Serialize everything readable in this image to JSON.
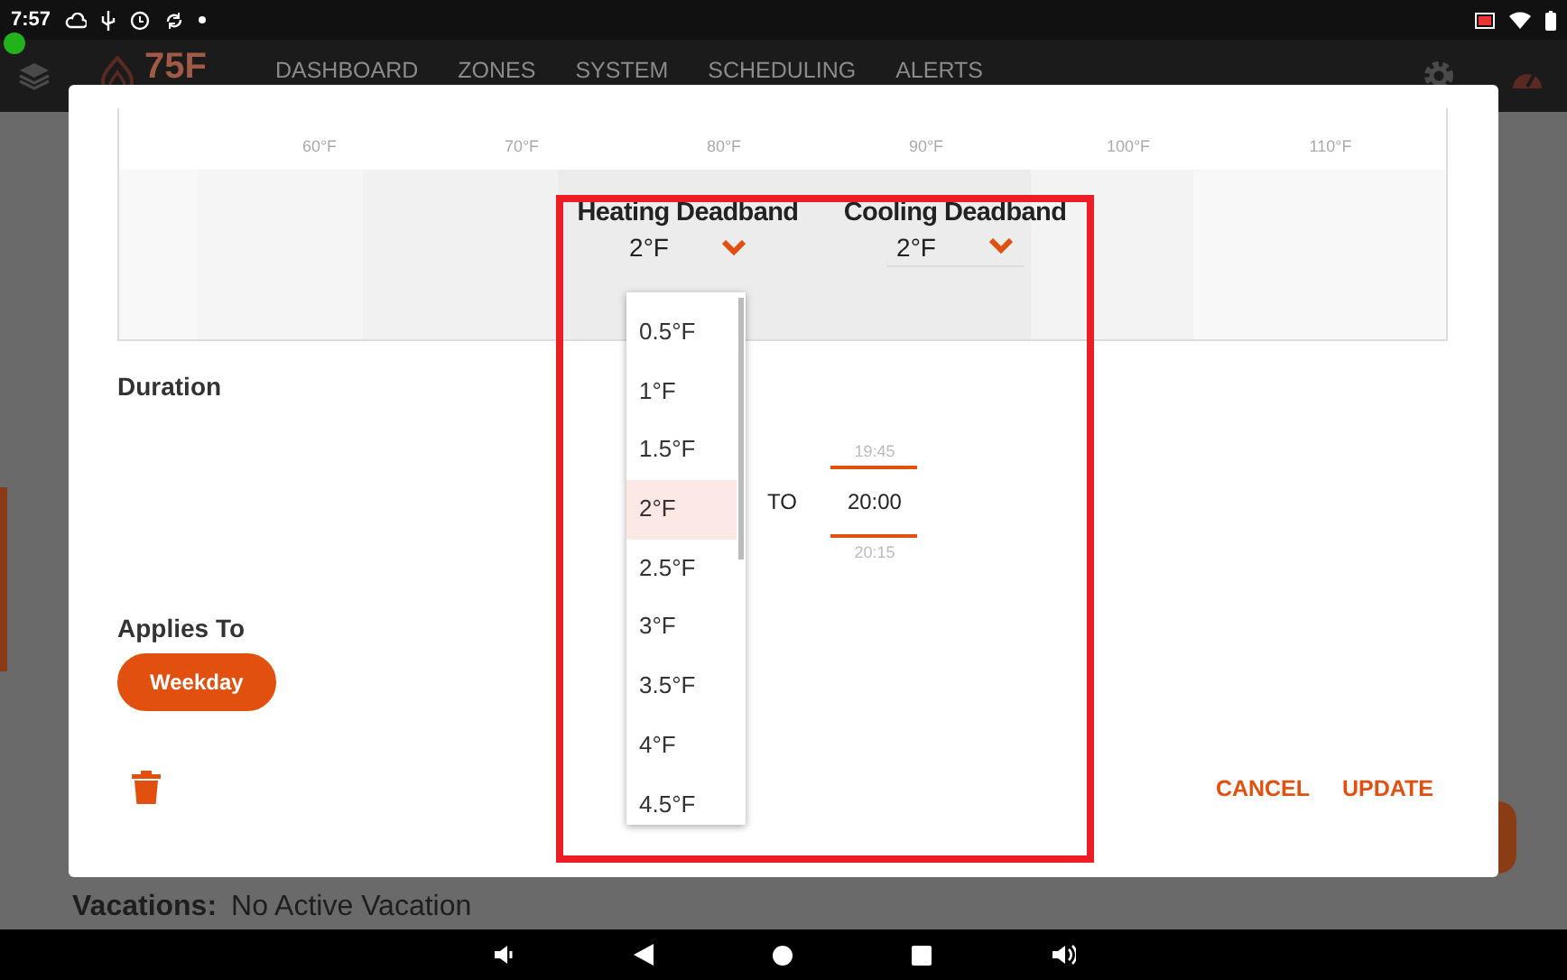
{
  "status_bar": {
    "time": "7:57"
  },
  "app_bar": {
    "logo": "75F",
    "nav": [
      {
        "label": "DASHBOARD"
      },
      {
        "label": "ZONES"
      },
      {
        "label": "SYSTEM"
      },
      {
        "label": "SCHEDULING"
      },
      {
        "label": "ALERTS"
      }
    ]
  },
  "background": {
    "vacations_label": "Vacations:",
    "vacations_value": "No Active Vacation"
  },
  "dialog": {
    "scale": {
      "ticks": [
        "60°F",
        "70°F",
        "80°F",
        "90°F",
        "100°F",
        "110°F"
      ]
    },
    "heating_deadband": {
      "label": "Heating Deadband",
      "value": "2°F",
      "expanded": true,
      "options": [
        {
          "label": "0.5°F",
          "selected": false
        },
        {
          "label": "1°F",
          "selected": false
        },
        {
          "label": "1.5°F",
          "selected": false
        },
        {
          "label": "2°F",
          "selected": true
        },
        {
          "label": "2.5°F",
          "selected": false
        },
        {
          "label": "3°F",
          "selected": false
        },
        {
          "label": "3.5°F",
          "selected": false
        },
        {
          "label": "4°F",
          "selected": false
        },
        {
          "label": "4.5°F",
          "selected": false
        }
      ]
    },
    "cooling_deadband": {
      "label": "Cooling Deadband",
      "value": "2°F",
      "expanded": false
    },
    "duration": {
      "label": "Duration",
      "to_label": "TO",
      "end_time": {
        "previous": "19:45",
        "value": "20:00",
        "next": "20:15"
      }
    },
    "applies_to": {
      "label": "Applies To",
      "chips": [
        {
          "label": "Weekday",
          "selected": true
        }
      ]
    },
    "actions": [
      "CANCEL",
      "UPDATE"
    ]
  }
}
